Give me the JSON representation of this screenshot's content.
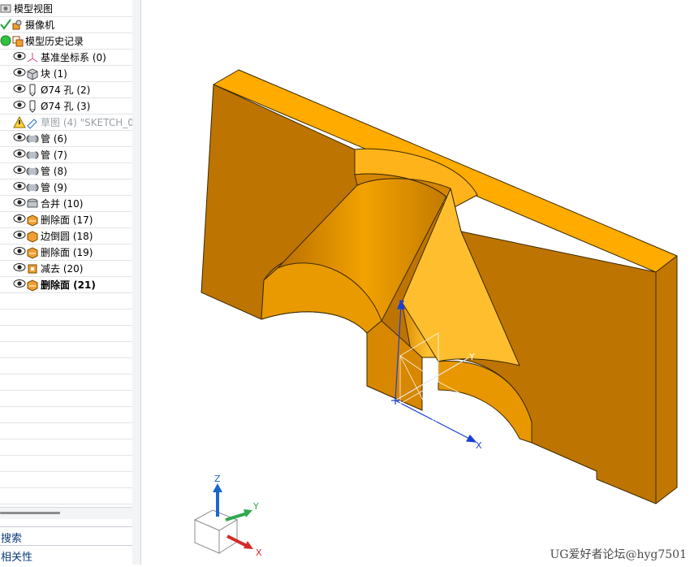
{
  "navigator": {
    "items": [
      {
        "label": "模型视图",
        "icon": "model-view-icon"
      },
      {
        "label": "摄像机",
        "icon": "camera-icon",
        "status": "check-icon"
      },
      {
        "label": "模型历史记录",
        "icon": "history-icon",
        "status": "green-dot-icon"
      },
      {
        "label": "基准坐标系 (0)",
        "icon": "datum-csys-icon"
      },
      {
        "label": "块 (1)",
        "icon": "block-icon"
      },
      {
        "label": "Ø74 孔 (2)",
        "icon": "hole-icon"
      },
      {
        "label": "Ø74 孔 (3)",
        "icon": "hole-icon"
      },
      {
        "label": "草图 (4) \"SKETCH_0",
        "icon": "sketch-icon",
        "status": "warning-icon",
        "disabled": true
      },
      {
        "label": "管 (6)",
        "icon": "tube-icon"
      },
      {
        "label": "管 (7)",
        "icon": "tube-icon"
      },
      {
        "label": "管 (8)",
        "icon": "tube-icon"
      },
      {
        "label": "管 (9)",
        "icon": "tube-icon"
      },
      {
        "label": "合并 (10)",
        "icon": "unite-icon"
      },
      {
        "label": "删除面 (17)",
        "icon": "delete-face-icon"
      },
      {
        "label": "边倒圆 (18)",
        "icon": "edge-blend-icon"
      },
      {
        "label": "删除面 (19)",
        "icon": "delete-face-icon"
      },
      {
        "label": "减去 (20)",
        "icon": "subtract-icon"
      },
      {
        "label": "删除面 (21)",
        "icon": "delete-face-icon",
        "bold": true
      }
    ],
    "panels": {
      "search": "搜索",
      "relevance": "相关性"
    }
  },
  "viewport": {
    "axis_labels": {
      "x": "X",
      "y": "Y",
      "z": "Z"
    },
    "triad_labels": {
      "x": "X",
      "y": "Y",
      "z": "Z"
    },
    "colors": {
      "part": "#f4a300",
      "edge": "#3b2a00",
      "x_axis": "#1a3fd6",
      "triad_z": "#1a66cc",
      "triad_y": "#2fa84f",
      "triad_x": "#d42a2a"
    }
  },
  "watermark": "UG爱好者论坛@hyg7501"
}
